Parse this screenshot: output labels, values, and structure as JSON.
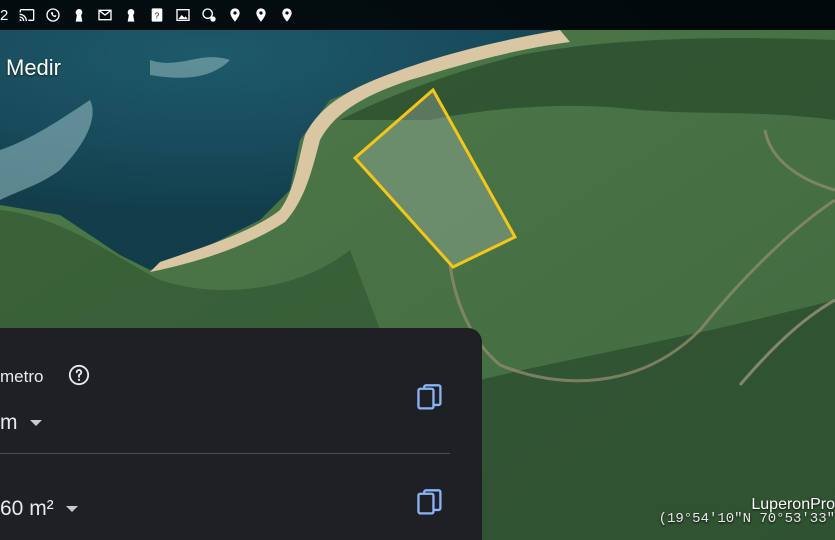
{
  "statusbar": {
    "left_text": "2",
    "icons": [
      "cast-icon",
      "whatsapp-icon",
      "keyhole-icon",
      "mail-icon",
      "keyhole-icon",
      "help-box-icon",
      "image-icon",
      "location-settings-icon",
      "location-pin-icon",
      "location-pin-icon",
      "location-pin-icon"
    ]
  },
  "toolbar": {
    "title": "Medir"
  },
  "panel": {
    "perimeter_label": "metro",
    "perimeter_value": "m",
    "area_value": "60 m²"
  },
  "map": {
    "attribution": "LuperonPro",
    "coordinates": "(19°54'10\"N 70°53'33\"",
    "polygon_color": "#f5c518"
  }
}
